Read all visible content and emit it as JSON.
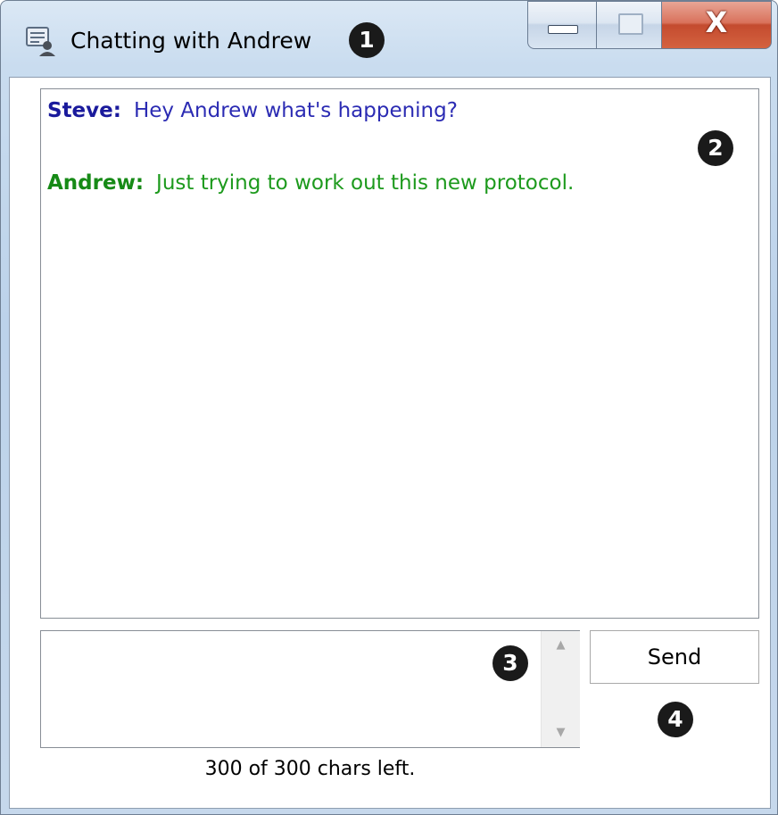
{
  "window": {
    "title": "Chatting with Andrew",
    "icon": "chat-window-icon",
    "controls": {
      "minimize": "minimize-icon",
      "maximize": "maximize-icon",
      "close_label": "X"
    }
  },
  "callouts": [
    "1",
    "2",
    "3",
    "4"
  ],
  "chat": {
    "messages": [
      {
        "sender": "Steve:",
        "text": "Hey Andrew what's happening?",
        "color": "#2b2bb3"
      },
      {
        "sender": "Andrew:",
        "text": "Just trying to work out this new protocol.",
        "color": "#1d9a1d"
      }
    ]
  },
  "compose": {
    "value": "",
    "send_label": "Send",
    "chars_left": "300 of 300 chars left."
  },
  "colors": {
    "close_button": "#c44b2f",
    "steve": "#1a1a9c",
    "andrew": "#168a16"
  }
}
